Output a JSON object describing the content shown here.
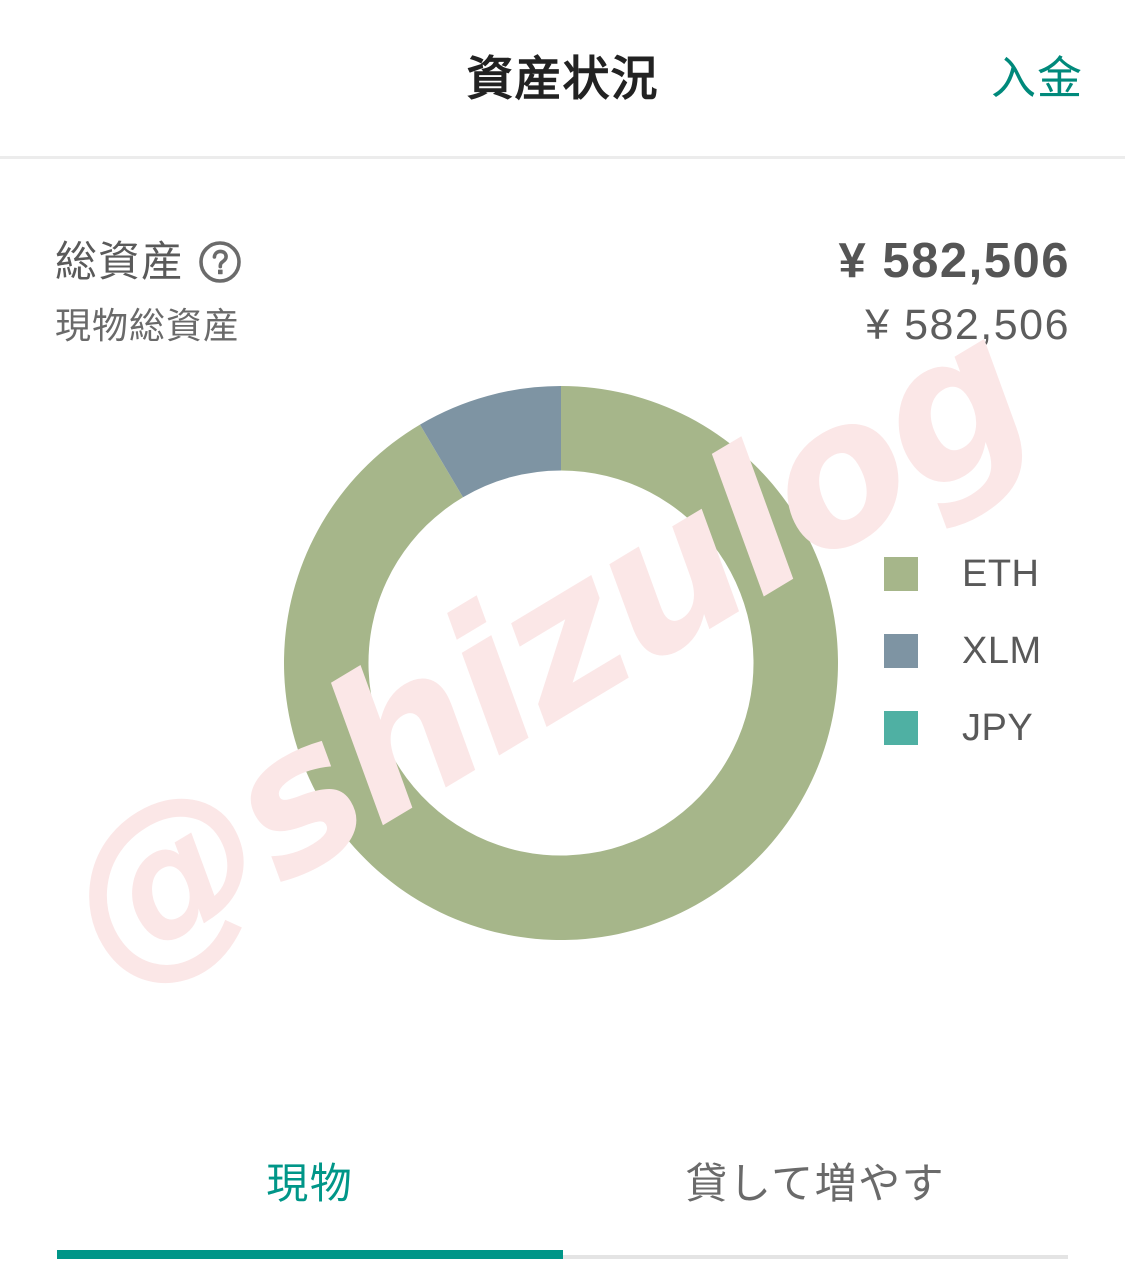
{
  "header": {
    "title": "資産状況",
    "action_label": "入金",
    "action_color": "#00897b"
  },
  "summary": {
    "primary_label": "総資産",
    "primary_help_icon": "help-circle-icon",
    "primary_value": "¥ 582,506",
    "secondary_label": "現物総資産",
    "secondary_value": "¥ 582,506"
  },
  "watermark": {
    "text": "@shizulog",
    "color": "#fbe7e7"
  },
  "legend": [
    {
      "label": "ETH",
      "color": "#a6b68a"
    },
    {
      "label": "XLM",
      "color": "#7e94a3"
    },
    {
      "label": "JPY",
      "color": "#4fb0a3"
    }
  ],
  "tabs": [
    {
      "label": "現物",
      "active": true
    },
    {
      "label": "貸して増やす",
      "active": false
    }
  ],
  "chart_data": {
    "type": "pie",
    "variant": "donut",
    "title": "",
    "categories": [
      "ETH",
      "XLM",
      "JPY"
    ],
    "values": [
      91.5,
      8.5,
      0.0
    ],
    "unit": "percent",
    "colors": [
      "#a6b68a",
      "#7e94a3",
      "#4fb0a3"
    ],
    "start_angle_deg": 0,
    "direction": "clockwise",
    "inner_radius_ratio": 0.695,
    "legend_position": "right",
    "grid": false,
    "annotations": []
  }
}
